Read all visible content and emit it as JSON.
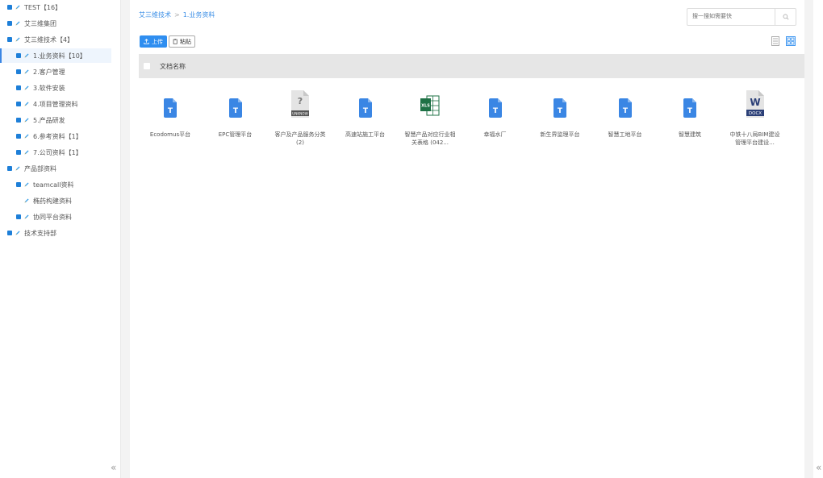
{
  "sidebar": {
    "items": [
      {
        "label": "TEST【16】",
        "indent": 0,
        "has_expander": true,
        "active": false
      },
      {
        "label": "艾三维集团",
        "indent": 0,
        "has_expander": true,
        "active": false
      },
      {
        "label": "艾三维技术【4】",
        "indent": 0,
        "has_expander": true,
        "active": false
      },
      {
        "label": "1.业务资料【10】",
        "indent": 1,
        "has_expander": true,
        "active": true
      },
      {
        "label": "2.客户管理",
        "indent": 1,
        "has_expander": true,
        "active": false
      },
      {
        "label": "3.软件安装",
        "indent": 1,
        "has_expander": true,
        "active": false
      },
      {
        "label": "4.项目管理资料",
        "indent": 1,
        "has_expander": true,
        "active": false
      },
      {
        "label": "5.产品研发",
        "indent": 1,
        "has_expander": true,
        "active": false
      },
      {
        "label": "6.参考资料【1】",
        "indent": 1,
        "has_expander": true,
        "active": false
      },
      {
        "label": "7.公司资料【1】",
        "indent": 1,
        "has_expander": true,
        "active": false
      },
      {
        "label": "产品部资料",
        "indent": 0,
        "has_expander": true,
        "active": false
      },
      {
        "label": "teamcall资料",
        "indent": 1,
        "has_expander": true,
        "active": false
      },
      {
        "label": "椭药构建资料",
        "indent": 1,
        "has_expander": false,
        "active": false
      },
      {
        "label": "协同平台资料",
        "indent": 1,
        "has_expander": true,
        "active": false
      },
      {
        "label": "技术支持部",
        "indent": 0,
        "has_expander": true,
        "active": false
      }
    ],
    "collapse_glyph": "«"
  },
  "breadcrumb": {
    "root": "艾三维技术",
    "separator": ">",
    "current": "1.业务资料"
  },
  "search": {
    "placeholder": "搜一搜如需要快"
  },
  "toolbar": {
    "upload_label": "上传",
    "paste_label": "粘贴"
  },
  "table": {
    "header_name": "文档名称"
  },
  "files": [
    {
      "name": "Ecodomus平台",
      "type": "doc"
    },
    {
      "name": "EPC管理平台",
      "type": "doc"
    },
    {
      "name": "客户及产品服务分类 (2)",
      "type": "unknown"
    },
    {
      "name": "高速站施工平台",
      "type": "doc"
    },
    {
      "name": "智慧产品对应行业相关表格 (042...",
      "type": "xlsx"
    },
    {
      "name": "幸福水厂",
      "type": "doc"
    },
    {
      "name": "新生界监理平台",
      "type": "doc"
    },
    {
      "name": "智慧工地平台",
      "type": "doc"
    },
    {
      "name": "智慧建筑",
      "type": "doc"
    },
    {
      "name": "中铁十八局BIM建设管理平台建设...",
      "type": "docx"
    }
  ],
  "icon_labels": {
    "doc": "T",
    "unknown_mark": "?",
    "unknown_tag": "UNKNOW",
    "docx_mark": "W",
    "docx_tag": "DOCX",
    "xlsx_tag": "XLS"
  },
  "right_collapse_glyph": "«",
  "colors": {
    "accent": "#2f8ef0",
    "doc_blue": "#3a86e4",
    "excel_green": "#1e7145",
    "word_navy": "#2b3f77",
    "header_gray": "#e6e6e6"
  }
}
